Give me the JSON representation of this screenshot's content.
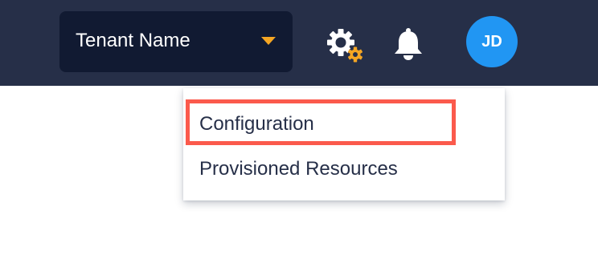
{
  "header": {
    "tenant_select": {
      "selected": "Tenant Name",
      "caret_icon": "caret-down-icon",
      "caret_color": "#f5a623"
    },
    "settings_icon": "gear-icon",
    "settings_accent_color": "#f5a623",
    "notifications_icon": "bell-icon",
    "avatar": {
      "initials": "JD",
      "color": "#2196f3"
    },
    "background_color": "#262f48"
  },
  "settings_menu": {
    "items": [
      {
        "label": "Configuration",
        "highlighted": true
      },
      {
        "label": "Provisioned Resources",
        "highlighted": false
      }
    ],
    "highlight_color": "#fb5a4c"
  }
}
